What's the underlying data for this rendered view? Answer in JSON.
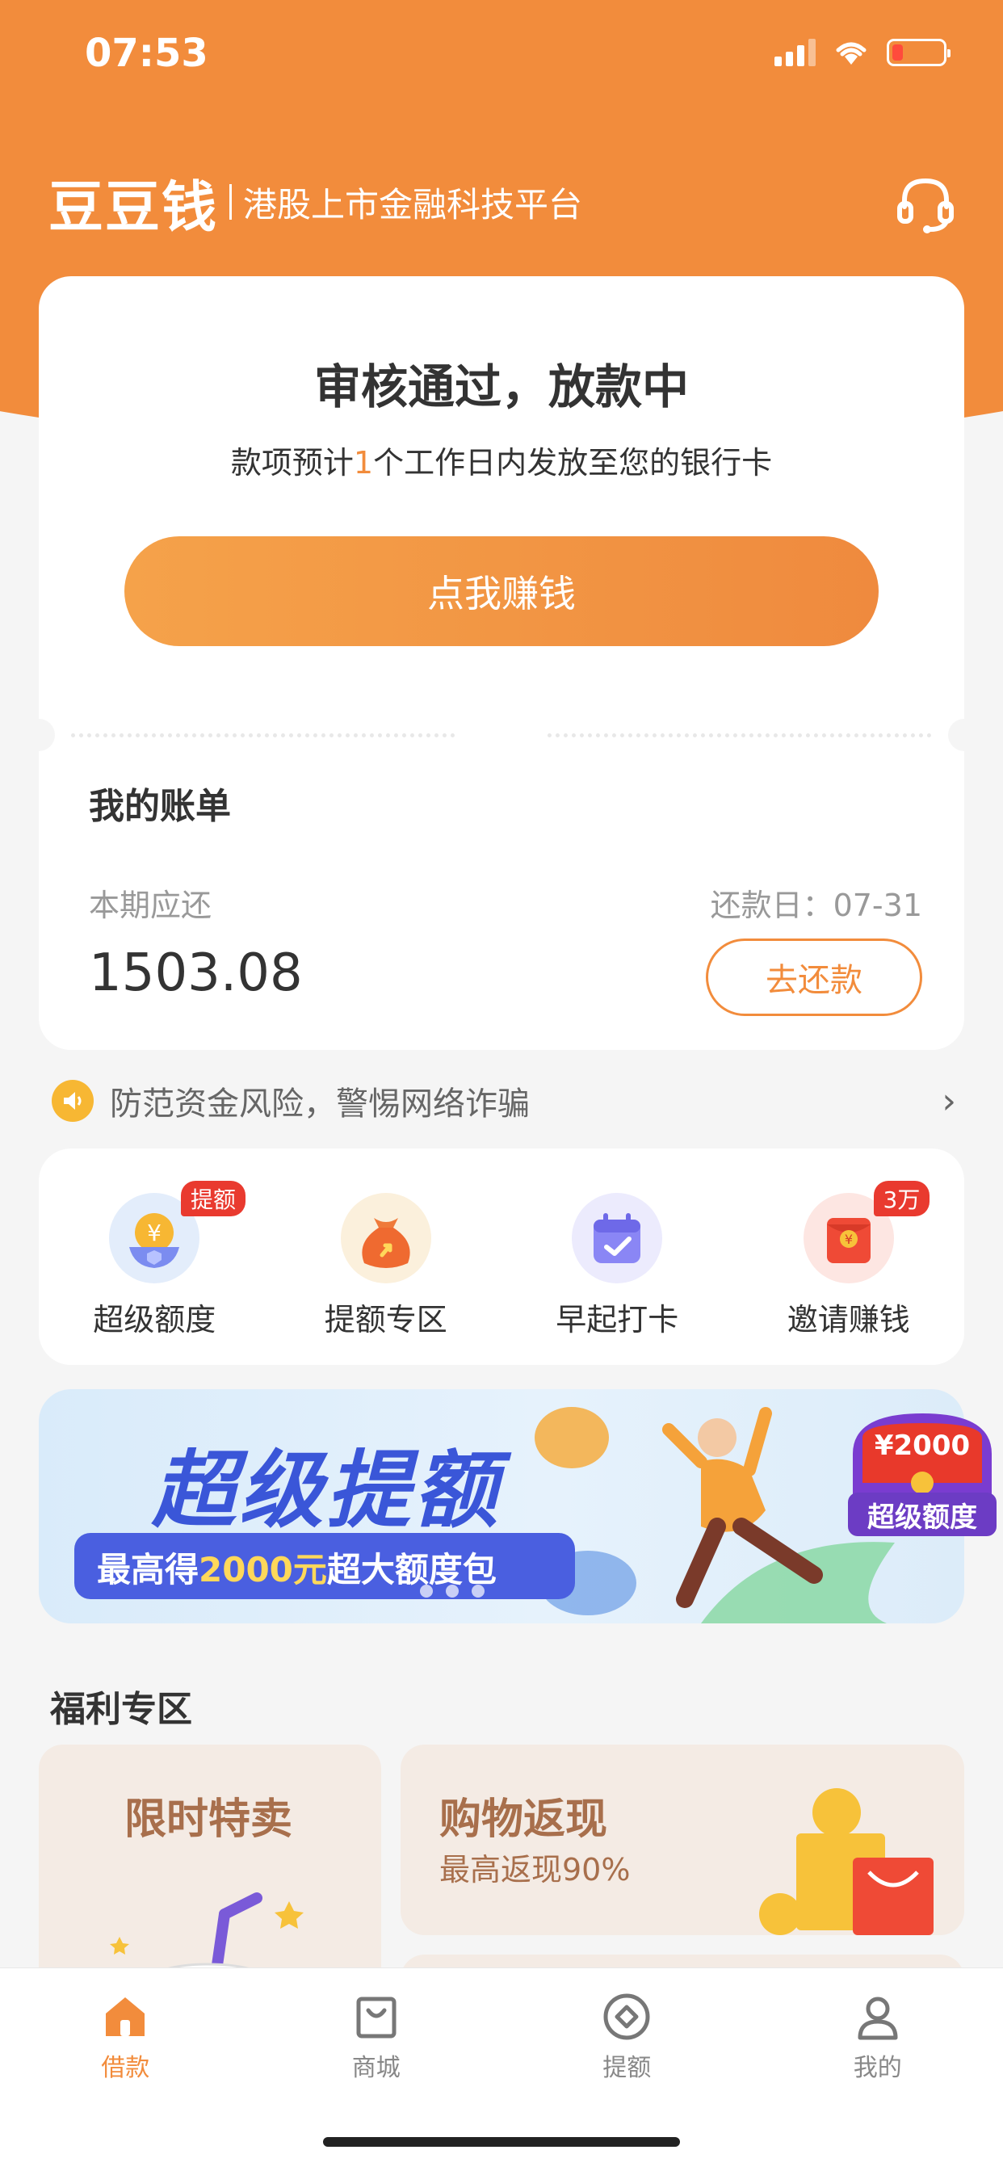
{
  "status_bar": {
    "time": "07:53"
  },
  "header": {
    "logo": "豆豆钱",
    "slogan": "港股上市金融科技平台"
  },
  "status_card": {
    "title": "审核通过，放款中",
    "subtitle_pre": "款项预计",
    "subtitle_days": "1",
    "subtitle_post": "个工作日内发放至您的银行卡",
    "earn_button": "点我赚钱"
  },
  "bill": {
    "title": "我的账单",
    "due_label": "本期应还",
    "due_date": "还款日：07-31",
    "amount": "1503.08",
    "repay_button": "去还款"
  },
  "notice": {
    "text": "防范资金风险，警惕网络诈骗"
  },
  "quick_menu": [
    {
      "label": "超级额度",
      "badge": "提额",
      "icon": "coin-shield-icon"
    },
    {
      "label": "提额专区",
      "badge": "",
      "icon": "money-bag-icon"
    },
    {
      "label": "早起打卡",
      "badge": "",
      "icon": "calendar-check-icon"
    },
    {
      "label": "邀请赚钱",
      "badge": "3万",
      "icon": "red-envelope-icon"
    }
  ],
  "banner": {
    "title": "超级提额",
    "sub_pre": "最高得",
    "sub_amount": "2000元",
    "sub_post": "超大额度包",
    "promo_amount": "¥2000",
    "promo_label": "超级额度"
  },
  "welfare": {
    "title": "福利专区",
    "left_title": "限时特卖",
    "right_title": "购物返现",
    "right_sub": "最高返现90%"
  },
  "tabs": [
    {
      "label": "借款",
      "icon": "home-icon",
      "active": true
    },
    {
      "label": "商城",
      "icon": "shopping-bag-icon",
      "active": false
    },
    {
      "label": "提额",
      "icon": "diamond-icon",
      "active": false
    },
    {
      "label": "我的",
      "icon": "user-icon",
      "active": false
    }
  ],
  "colors": {
    "brand": "#f28c3c",
    "badge": "#e93a2f",
    "banner_blue": "#3a56d8"
  }
}
